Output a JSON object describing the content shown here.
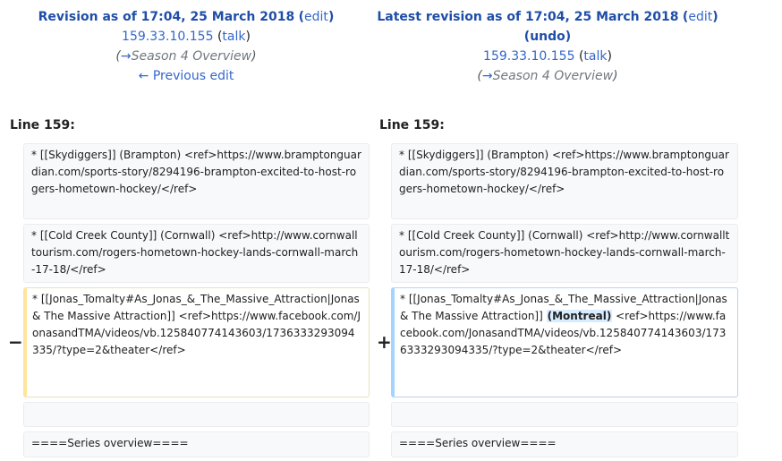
{
  "left_header": {
    "title_prefix": "Revision as of 17:04, 25 March 2018",
    "edit_label": "edit",
    "user": "159.33.10.155",
    "talk_label": "talk",
    "arrow": "→",
    "section": "Season 4 Overview",
    "prev_label": "← Previous edit"
  },
  "right_header": {
    "title_prefix": "Latest revision as of 17:04, 25 March 2018",
    "edit_label": "edit",
    "undo_label": "undo",
    "user": "159.33.10.155",
    "talk_label": "talk",
    "arrow": "→",
    "section": "Season 4 Overview"
  },
  "line_number_left": "Line 159:",
  "line_number_right": "Line 159:",
  "markers": {
    "minus": "−",
    "plus": "+"
  },
  "left_rows": [
    "* [[Skydiggers]] (Brampton) <ref>https://www.bramptonguardian.com/sports-story/8294196-brampton-excited-to-host-rogers-hometown-hockey/</ref>",
    "* [[Cold Creek County]] (Cornwall) <ref>http://www.cornwalltourism.com/rogers-hometown-hockey-lands-cornwall-march-17-18/</ref>",
    "* [[Jonas_Tomalty#As_Jonas_&_The_Massive_Attraction|Jonas & The Massive Attraction]] <ref>https://www.facebook.com/JonasandTMA/videos/vb.125840774143603/1736333293094335/?type=2&theater</ref>",
    "",
    "====Series overview===="
  ],
  "right_rows": [
    "* [[Skydiggers]] (Brampton) <ref>https://www.bramptonguardian.com/sports-story/8294196-brampton-excited-to-host-rogers-hometown-hockey/</ref>",
    "* [[Cold Creek County]] (Cornwall) <ref>http://www.cornwalltourism.com/rogers-hometown-hockey-lands-cornwall-march-17-18/</ref>",
    {
      "before": "* [[Jonas_Tomalty#As_Jonas_&_The_Massive_Attraction|Jonas & The Massive Attraction]] ",
      "inserted": "(Montreal)",
      "after": " <ref>https://www.facebook.com/JonasandTMA/videos/vb.125840774143603/1736333293094335/?type=2&theater</ref>"
    },
    "",
    "====Series overview===="
  ]
}
